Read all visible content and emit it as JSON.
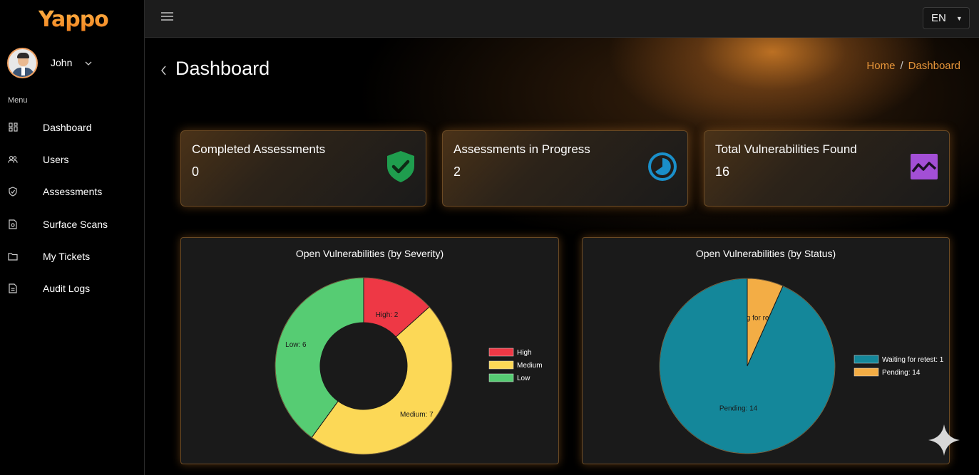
{
  "sidebar": {
    "logo": "Yappo",
    "user": {
      "name": "John"
    },
    "menu_label": "Menu",
    "items": [
      {
        "label": "Dashboard",
        "icon": "dashboard-icon"
      },
      {
        "label": "Users",
        "icon": "users-icon"
      },
      {
        "label": "Assessments",
        "icon": "shield-icon"
      },
      {
        "label": "Surface Scans",
        "icon": "file-scan-icon"
      },
      {
        "label": "My Tickets",
        "icon": "folder-icon"
      },
      {
        "label": "Audit Logs",
        "icon": "document-icon"
      }
    ]
  },
  "topbar": {
    "language": "EN"
  },
  "header": {
    "title": "Dashboard",
    "breadcrumb": [
      "Home",
      "Dashboard"
    ]
  },
  "stats": [
    {
      "title": "Completed Assessments",
      "value": "0",
      "icon": "shield-check-icon",
      "color": "#1f9d4e"
    },
    {
      "title": "Assessments in Progress",
      "value": "2",
      "icon": "progress-clock-icon",
      "color": "#1a8fc9"
    },
    {
      "title": "Total Vulnerabilities Found",
      "value": "16",
      "icon": "chart-wave-icon",
      "color": "#a34fd6"
    }
  ],
  "chart_data": [
    {
      "type": "pie",
      "donut": true,
      "title": "Open Vulnerabilities (by Severity)",
      "categories": [
        "High",
        "Medium",
        "Low"
      ],
      "values": [
        2,
        7,
        6
      ],
      "slice_labels": [
        "High: 2",
        "Medium: 7",
        "Low: 6"
      ],
      "colors": [
        "#ee3845",
        "#fcd856",
        "#56cc73"
      ],
      "legend": "right"
    },
    {
      "type": "pie",
      "donut": false,
      "title": "Open Vulnerabilities (by Status)",
      "categories": [
        "Waiting for retest: 1",
        "Pending: 14"
      ],
      "values": [
        1,
        14
      ],
      "slice_labels": [
        "Waiting for retest: 1",
        "Pending: 14"
      ],
      "colors": [
        "#f3ad45",
        "#14879a"
      ],
      "legend_colors": [
        "#14879a",
        "#f3ad45"
      ],
      "legend": "right"
    }
  ]
}
